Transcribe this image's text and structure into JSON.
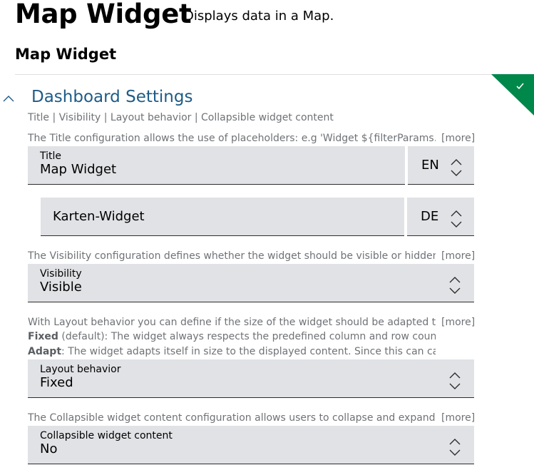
{
  "header": {
    "title": "Map Widget",
    "subtitle": "Displays data in a Map.",
    "widget_name": "Map Widget"
  },
  "section": {
    "title": "Dashboard Settings",
    "breadcrumb": "Title | Visibility | Layout behavior | Collapsible widget content",
    "expanded": true
  },
  "title_config": {
    "description": "The Title configuration allows the use of placeholders: e.g 'Widget ${filterParams.p...",
    "more": "[more]",
    "label": "Title",
    "value_en": "Map Widget",
    "lang_en": "EN",
    "value_de": "Karten-Widget",
    "lang_de": "DE"
  },
  "visibility_config": {
    "description": "The Visibility configuration defines whether the widget should be visible or hidden, ...",
    "more": "[more]",
    "label": "Visibility",
    "value": "Visible"
  },
  "layout_config": {
    "description": "With Layout behavior you can define if the size of the widget should be adapted to t...",
    "more": "[more]",
    "fixed_term": "Fixed",
    "fixed_text": " (default): The widget always respects the predefined column and row count s...",
    "adapt_term": "Adapt",
    "adapt_text": ": The widget adapts itself in size to the displayed content. Since this can caus...",
    "label": "Layout behavior",
    "value": "Fixed"
  },
  "collapsible_config": {
    "description": "The Collapsible widget content configuration allows users to collapse and expand t...",
    "more": "[more]",
    "label": "Collapsible widget content",
    "value": "No"
  },
  "colors": {
    "accent": "#1e5b86",
    "success": "#00884a",
    "field_bg": "#e0e2e5"
  },
  "icons": [
    "chevron-up-icon",
    "checkmark-icon",
    "spinner-up-down-icon"
  ]
}
